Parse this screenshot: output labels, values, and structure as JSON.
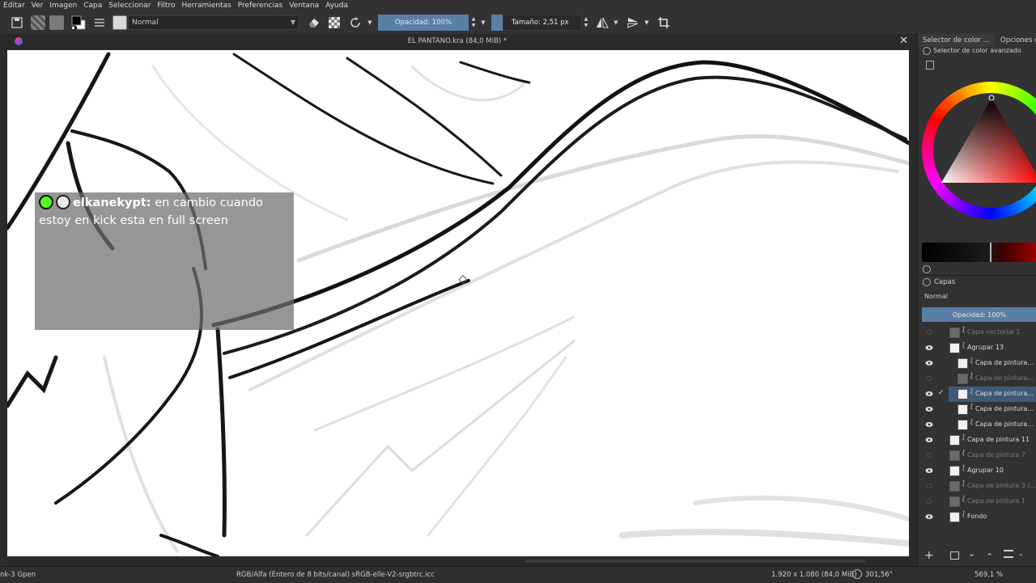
{
  "menu": [
    "Editar",
    "Ver",
    "Imagen",
    "Capa",
    "Seleccionar",
    "Filtro",
    "Herramientas",
    "Preferencias",
    "Ventana",
    "Ayuda"
  ],
  "toolbar": {
    "blend_mode": "Normal",
    "opacity_label": "Opacidad: 100%",
    "size_label": "Tamaño: 2,51 px"
  },
  "document": {
    "title": "EL PANTANO.kra (84,0 MiB) *"
  },
  "chat": {
    "username": "elkanekypt:",
    "message": "en cambio cuando estoy en kick esta en full screen"
  },
  "panel": {
    "tabs": [
      "Selector de color ...",
      "Opciones de"
    ],
    "color_selector_title": "Selector de color avanzado",
    "layers_title": "Capas",
    "layers_blend": "Normal",
    "layers_opacity": "Opacidad:  100%",
    "layers": [
      {
        "name": "Capa vectorial 1",
        "visible": false,
        "dim": true,
        "indent": 0,
        "group": false
      },
      {
        "name": "Agrupar 13",
        "visible": true,
        "dim": false,
        "indent": 0,
        "group": true
      },
      {
        "name": "Capa de pintura...",
        "visible": true,
        "dim": false,
        "indent": 1,
        "group": false
      },
      {
        "name": "Capa de pintura...",
        "visible": false,
        "dim": true,
        "indent": 1,
        "group": false
      },
      {
        "name": "Capa de pintura...",
        "visible": true,
        "dim": false,
        "indent": 1,
        "group": false,
        "selected": true
      },
      {
        "name": "Capa de pintura...",
        "visible": true,
        "dim": false,
        "indent": 1,
        "group": false
      },
      {
        "name": "Capa de pintura...",
        "visible": true,
        "dim": false,
        "indent": 1,
        "group": false
      },
      {
        "name": "Capa de pintura 11",
        "visible": true,
        "dim": false,
        "indent": 0,
        "group": false
      },
      {
        "name": "Capa de pintura 7",
        "visible": false,
        "dim": true,
        "indent": 0,
        "group": false
      },
      {
        "name": "Agrupar 10",
        "visible": true,
        "dim": false,
        "indent": 0,
        "group": true
      },
      {
        "name": "Capa de pintura 3 (...",
        "visible": false,
        "dim": true,
        "indent": 0,
        "group": false
      },
      {
        "name": "Capa de pintura 1",
        "visible": false,
        "dim": true,
        "indent": 0,
        "group": false
      },
      {
        "name": "Fondo",
        "visible": true,
        "dim": false,
        "indent": 0,
        "group": false
      }
    ]
  },
  "status": {
    "brush": "nk-3 Gpen",
    "color_space": "RGB/Alfa (Entero de 8 bits/canal)  sRGB-elle-V2-srgbtrc.icc",
    "dimensions": "1.920 x 1.080 (84,0 MiB)",
    "rotation": "301,56°",
    "zoom": "569,1 %"
  },
  "colors": {
    "accent": "#5a7fa6",
    "selection": "#3f5a78",
    "canvas": "#ffffff",
    "ui_bg": "#323232"
  }
}
